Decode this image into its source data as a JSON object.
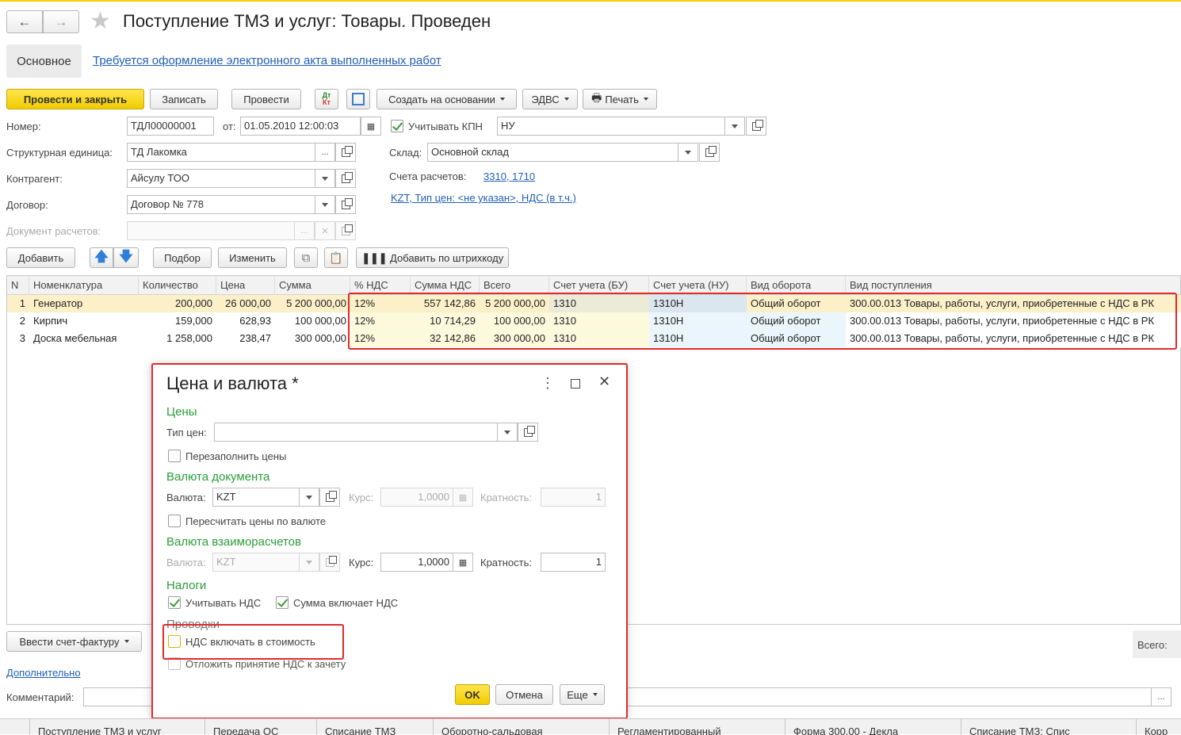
{
  "window": {
    "title": "Поступление ТМЗ и услуг: Товары. Проведен"
  },
  "nav": {
    "tab_main": "Основное",
    "act_link": "Требуется оформление электронного акта выполненных работ"
  },
  "toolbar": {
    "post_close": "Провести и закрыть",
    "save": "Записать",
    "post": "Провести",
    "create_based": "Создать на основании",
    "edvs": "ЭДВС",
    "print": "Печать"
  },
  "form": {
    "number_label": "Номер:",
    "number": "ТДЛ00000001",
    "from_label": "от:",
    "date": "01.05.2010 12:00:03",
    "kpn_label": "Учитывать КПН",
    "kpn_value": "НУ",
    "unit_label": "Структурная единица:",
    "unit": "ТД Лакомка",
    "warehouse_label": "Склад:",
    "warehouse": "Основной склад",
    "contractor_label": "Контрагент:",
    "contractor": "Айсулу ТОО",
    "accounts_label": "Счета расчетов:",
    "accounts_link": "3310, 1710",
    "contract_label": "Договор:",
    "contract": "Договор № 778",
    "price_link": "KZT, Тип цен: <не указан>, НДС (в т.ч.)",
    "settle_doc_label": "Документ расчетов:"
  },
  "table_toolbar": {
    "add": "Добавить",
    "pick": "Подбор",
    "edit": "Изменить",
    "barcode": "Добавить по штрихкоду"
  },
  "table": {
    "headers": [
      "N",
      "Номенклатура",
      "Количество",
      "Цена",
      "Сумма",
      "% НДС",
      "Сумма НДС",
      "Всего",
      "Счет учета (БУ)",
      "Счет учета (НУ)",
      "Вид оборота",
      "Вид поступления"
    ],
    "rows": [
      [
        "1",
        "Генератор",
        "200,000",
        "26 000,00",
        "5 200 000,00",
        "12%",
        "557 142,86",
        "5 200 000,00",
        "1310",
        "1310Н",
        "Общий оборот",
        "300.00.013 Товары, работы, услуги, приобретенные с НДС в РК"
      ],
      [
        "2",
        "Кирпич",
        "159,000",
        "628,93",
        "100 000,00",
        "12%",
        "10 714,29",
        "100 000,00",
        "1310",
        "1310Н",
        "Общий оборот",
        "300.00.013 Товары, работы, услуги, приобретенные с НДС в РК"
      ],
      [
        "3",
        "Доска мебельная",
        "1 258,000",
        "238,47",
        "300 000,00",
        "12%",
        "32 142,86",
        "300 000,00",
        "1310",
        "1310Н",
        "Общий оборот",
        "300.00.013 Товары, работы, услуги, приобретенные с НДС в РК"
      ]
    ]
  },
  "footer": {
    "invoice": "Ввести счет-фактуру",
    "more_link": "Дополнительно",
    "comment_label": "Комментарий:",
    "total_label": "Всего:"
  },
  "dialog": {
    "title": "Цена и валюта *",
    "prices_section": "Цены",
    "price_type_label": "Тип цен:",
    "price_type": "",
    "refill_prices": "Перезаполнить цены",
    "doc_currency_section": "Валюта документа",
    "currency_label": "Валюта:",
    "currency": "KZT",
    "rate_label": "Курс:",
    "rate": "1,0000",
    "mult_label": "Кратность:",
    "mult": "1",
    "recalc": "Пересчитать цены по валюте",
    "settle_section": "Валюта взаиморасчетов",
    "settle_currency": "KZT",
    "settle_rate": "1,0000",
    "settle_mult": "1",
    "taxes_section": "Налоги",
    "use_vat": "Учитывать НДС",
    "sum_incl_vat": "Сумма включает НДС",
    "postings_section": "Проводки",
    "vat_in_cost": "НДС включать в стоимость",
    "defer_vat": "Отложить принятие НДС к зачету",
    "ok": "OK",
    "cancel": "Отмена",
    "more": "Еще"
  },
  "tabs": [
    "Поступление ТМЗ и услуг",
    "Передача ОС",
    "Списание ТМЗ",
    "Оборотно-сальдовая",
    "Регламентированный",
    "Форма 300.00 - Декла",
    "Списание ТМЗ: Спис",
    "Корр"
  ],
  "colors": {
    "accent_yellow": "#f5d300",
    "green": "#2a9d3a",
    "red": "#e02b2b",
    "link": "#1f5fb5"
  }
}
